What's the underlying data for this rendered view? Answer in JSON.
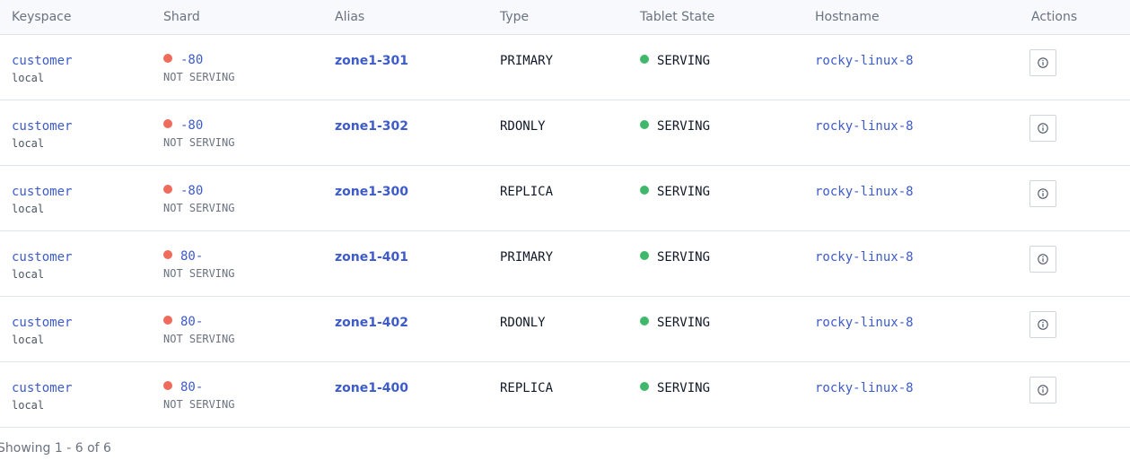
{
  "colors": {
    "link": "#3d5bc9",
    "not_serving": "#ef6b5b",
    "serving": "#3fb86b"
  },
  "table": {
    "headers": {
      "keyspace": "Keyspace",
      "shard": "Shard",
      "alias": "Alias",
      "type": "Type",
      "tablet_state": "Tablet State",
      "hostname": "Hostname",
      "actions": "Actions"
    },
    "rows": [
      {
        "keyspace": "customer",
        "cell": "local",
        "shard": "-80",
        "shard_state": "NOT SERVING",
        "alias": "zone1-301",
        "type": "PRIMARY",
        "tablet_state": "SERVING",
        "hostname": "rocky-linux-8",
        "action_icon": "info-icon"
      },
      {
        "keyspace": "customer",
        "cell": "local",
        "shard": "-80",
        "shard_state": "NOT SERVING",
        "alias": "zone1-302",
        "type": "RDONLY",
        "tablet_state": "SERVING",
        "hostname": "rocky-linux-8",
        "action_icon": "info-icon"
      },
      {
        "keyspace": "customer",
        "cell": "local",
        "shard": "-80",
        "shard_state": "NOT SERVING",
        "alias": "zone1-300",
        "type": "REPLICA",
        "tablet_state": "SERVING",
        "hostname": "rocky-linux-8",
        "action_icon": "info-icon"
      },
      {
        "keyspace": "customer",
        "cell": "local",
        "shard": "80-",
        "shard_state": "NOT SERVING",
        "alias": "zone1-401",
        "type": "PRIMARY",
        "tablet_state": "SERVING",
        "hostname": "rocky-linux-8",
        "action_icon": "info-icon"
      },
      {
        "keyspace": "customer",
        "cell": "local",
        "shard": "80-",
        "shard_state": "NOT SERVING",
        "alias": "zone1-402",
        "type": "RDONLY",
        "tablet_state": "SERVING",
        "hostname": "rocky-linux-8",
        "action_icon": "info-icon"
      },
      {
        "keyspace": "customer",
        "cell": "local",
        "shard": "80-",
        "shard_state": "NOT SERVING",
        "alias": "zone1-400",
        "type": "REPLICA",
        "tablet_state": "SERVING",
        "hostname": "rocky-linux-8",
        "action_icon": "info-icon"
      }
    ]
  },
  "footer": {
    "showing": "Showing 1 - 6 of 6"
  }
}
